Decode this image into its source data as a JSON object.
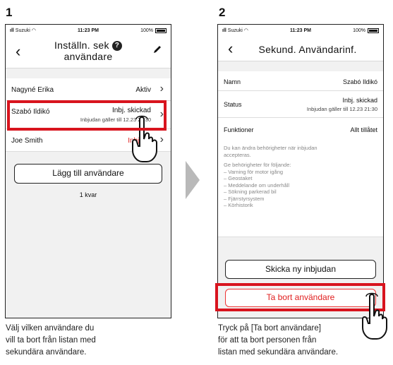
{
  "step1": {
    "number": "1",
    "status": {
      "carrier": "Suzuki",
      "time": "11:23 PM",
      "battery": "100%"
    },
    "nav": {
      "back_icon": "back-chevron-icon",
      "title_line1": "Inställn. sek",
      "title_line2": "användare",
      "help": "?",
      "edit_icon": "pencil-icon"
    },
    "users": [
      {
        "name": "Nagyné Erika",
        "status": "Aktiv"
      },
      {
        "name": "Szabó Ildikó",
        "status": "Inbj. skickad",
        "sub": "Inbjudan gäller till 12.23 21:30"
      },
      {
        "name": "Joe Smith",
        "status": "Inbju. u"
      }
    ],
    "add_button": "Lägg till användare",
    "remaining": "1 kvar",
    "caption": [
      "Välj vilken användare du",
      "vill ta bort från listan med",
      "sekundära användare."
    ]
  },
  "step2": {
    "number": "2",
    "status": {
      "carrier": "Suzuki",
      "time": "11:23 PM",
      "battery": "100%"
    },
    "nav": {
      "title": "Sekund. Användarinf."
    },
    "name_label": "Namn",
    "name_value": "Szabó Ildikó",
    "status_label": "Status",
    "status_value": "Inbj. skickad",
    "status_sub": "Inbjudan gäller till 12.23 21:30",
    "functions_label": "Funktioner",
    "functions_value": "Allt tillåtet",
    "note1": "Du kan ändra behörigheter när inbjudan",
    "note1b": "accepteras.",
    "note2": "Ge behörigheter för följande:",
    "permissions": [
      "– Varning för motor igång",
      "– Geostaket",
      "– Meddelande om underhåll",
      "– Sökning parkerad bil",
      "– Fjärrstyrsystem",
      "– Körhistorik"
    ],
    "resend_button": "Skicka ny inbjudan",
    "remove_button": "Ta bort användare",
    "caption": [
      "Tryck på [Ta bort användare]",
      "för att ta bort personen från",
      "listan med sekundära användare."
    ]
  }
}
